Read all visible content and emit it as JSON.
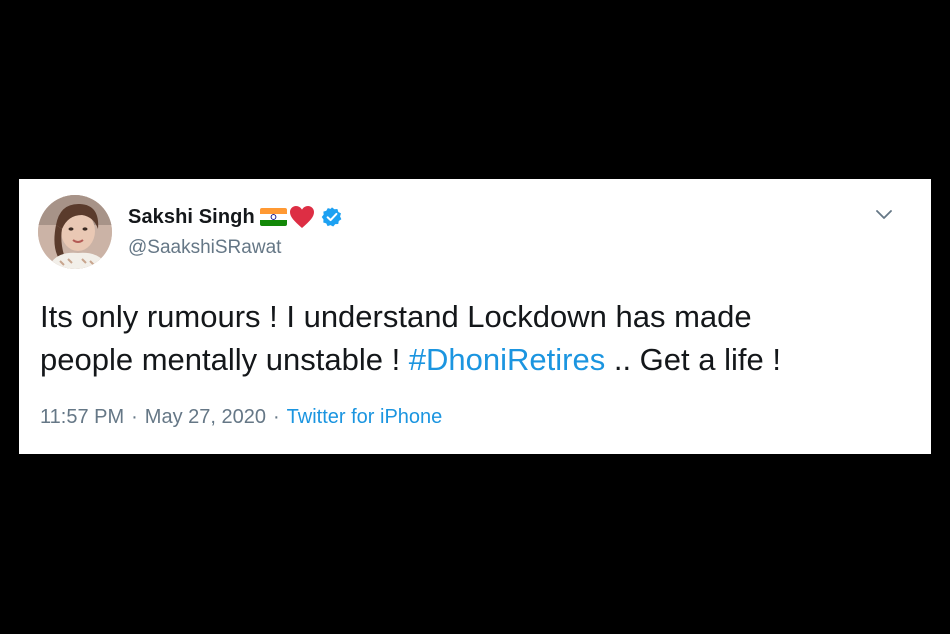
{
  "tweet": {
    "author": {
      "display_name": "Sakshi Singh",
      "handle": "@SaakshiSRawat",
      "verified": true,
      "name_emoji": [
        "india-flag-icon",
        "red-heart-icon"
      ]
    },
    "text": {
      "line1": "Its only rumours ! I understand Lockdown has made",
      "line2_before": "people mentally unstable ! ",
      "hashtag": "#DhoniRetires",
      "line2_after": " .. Get a life !"
    },
    "meta": {
      "time": "11:57 PM",
      "separator": "·",
      "date": "May 27, 2020",
      "source": "Twitter for iPhone"
    }
  },
  "colors": {
    "background": "#000000",
    "card": "#ffffff",
    "text": "#14171a",
    "secondary": "#657786",
    "link": "#1b95e0",
    "verified": "#1da1f2",
    "heart": "#dd2e44"
  }
}
